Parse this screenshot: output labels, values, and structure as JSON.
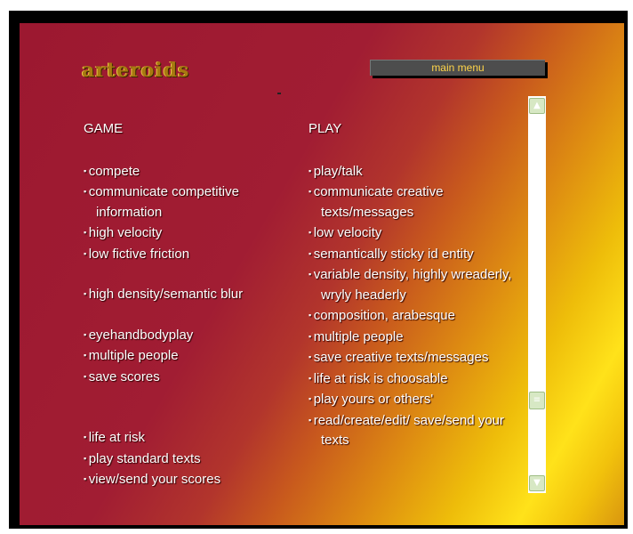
{
  "header": {
    "logo_text": "arteroids",
    "menu_button_label": "main menu"
  },
  "game": {
    "heading": "GAME",
    "items": [
      "compete",
      "communicate competitive information",
      "high velocity",
      "low fictive friction",
      "high density/semantic blur",
      "eyehandbodyplay",
      "multiple people",
      "save scores",
      "life at risk",
      "play standard texts",
      "view/send your scores"
    ]
  },
  "play": {
    "heading": "PLAY",
    "items": [
      "play/talk",
      "communicate creative texts/messages",
      "low velocity",
      "semantically sticky id entity",
      "variable density, highly wreaderly, wryly headerly",
      "composition, arabesque",
      "multiple people",
      "save creative texts/messages",
      "life at risk is choosable",
      "play yours or others'",
      "read/create/edit/ save/send your texts"
    ]
  },
  "scrollbar": {
    "up_icon": "chevron-up",
    "down_icon": "chevron-down",
    "thumb_icon": "grip-lines",
    "thumb_color": "#d7e8c4"
  },
  "colors": {
    "background_dark": "#9c1830",
    "background_light": "#ffe21a",
    "text": "#ffffff",
    "menu_button": "#4d4d4d",
    "menu_text": "#ffd54a"
  }
}
